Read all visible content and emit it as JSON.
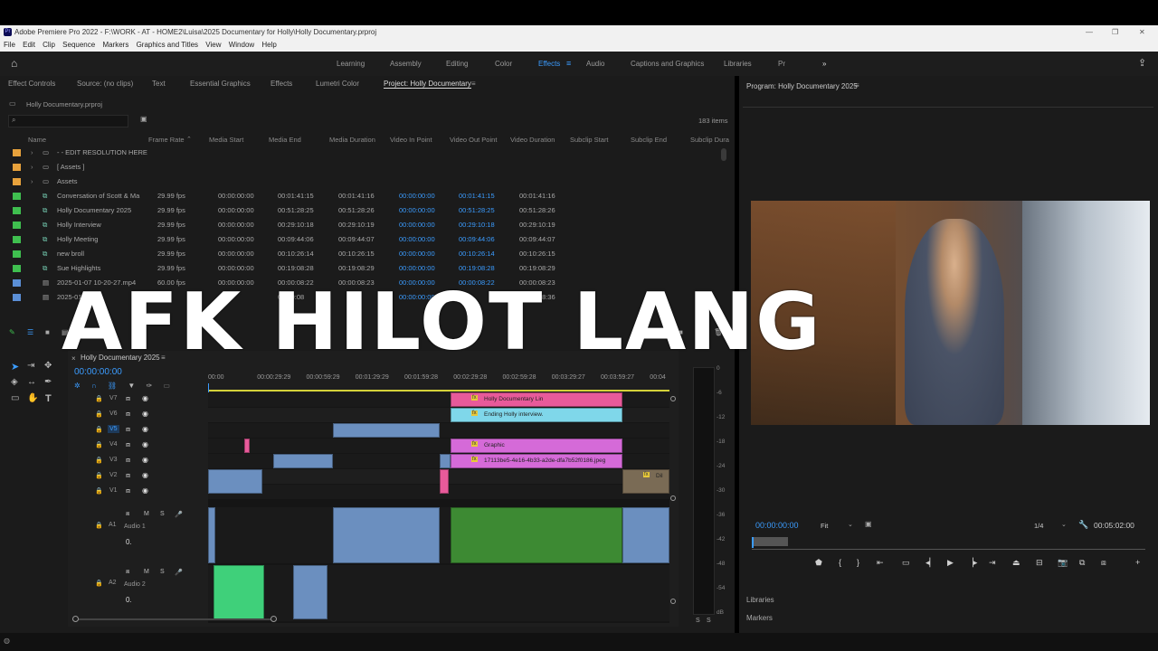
{
  "app": {
    "title": "Adobe Premiere Pro 2022 - F:\\WORK - AT - HOME2\\Luisa\\2025 Documentary for Holly\\Holly Documentary.prproj",
    "icon_text": "Pr"
  },
  "menu": [
    "File",
    "Edit",
    "Clip",
    "Sequence",
    "Markers",
    "Graphics and Titles",
    "View",
    "Window",
    "Help"
  ],
  "workspaces": {
    "items": [
      "Learning",
      "Assembly",
      "Editing",
      "Color",
      "Effects",
      "Audio",
      "Captions and Graphics",
      "Libraries",
      "Pr"
    ],
    "active": "Effects",
    "more": "»"
  },
  "left_tabs": [
    "Effect Controls",
    "Source: (no clips)",
    "Text",
    "Essential Graphics",
    "Effects",
    "Lumetri Color",
    "Project: Holly Documentary"
  ],
  "project": {
    "filename": "Holly Documentary.prproj",
    "item_count": "183 items",
    "columns": [
      "Name",
      "Frame Rate",
      "Media Start",
      "Media End",
      "Media Duration",
      "Video In Point",
      "Video Out Point",
      "Video Duration",
      "Subclip Start",
      "Subclip End",
      "Subclip Dura"
    ],
    "rows": [
      {
        "name": "- - EDIT RESOLUTION HERE",
        "color": "#e8a23c",
        "type": "bin",
        "fps": "",
        "ms": "",
        "me": "",
        "md": "",
        "vin": "",
        "vout": "",
        "vd": ""
      },
      {
        "name": "[ Assets ]",
        "color": "#e8a23c",
        "type": "bin",
        "fps": "",
        "ms": "",
        "me": "",
        "md": "",
        "vin": "",
        "vout": "",
        "vd": ""
      },
      {
        "name": "Assets",
        "color": "#e8a23c",
        "type": "bin",
        "fps": "",
        "ms": "",
        "me": "",
        "md": "",
        "vin": "",
        "vout": "",
        "vd": ""
      },
      {
        "name": "Conversation of Scott & Ma",
        "color": "#3fbf4f",
        "type": "seq",
        "fps": "29.99 fps",
        "ms": "00:00:00:00",
        "me": "00:01:41:15",
        "md": "00:01:41:16",
        "vin": "00:00:00:00",
        "vout": "00:01:41:15",
        "vd": "00:01:41:16"
      },
      {
        "name": "Holly Documentary 2025",
        "color": "#3fbf4f",
        "type": "seq",
        "fps": "29.99 fps",
        "ms": "00:00:00:00",
        "me": "00:51:28:25",
        "md": "00:51:28:26",
        "vin": "00:00:00:00",
        "vout": "00:51:28:25",
        "vd": "00:51:28:26"
      },
      {
        "name": "Holly Interview",
        "color": "#3fbf4f",
        "type": "seq",
        "fps": "29.99 fps",
        "ms": "00:00:00:00",
        "me": "00:29:10:18",
        "md": "00:29:10:19",
        "vin": "00:00:00:00",
        "vout": "00:29:10:18",
        "vd": "00:29:10:19"
      },
      {
        "name": "Holly Meeting",
        "color": "#3fbf4f",
        "type": "seq",
        "fps": "29.99 fps",
        "ms": "00:00:00:00",
        "me": "00:09:44:06",
        "md": "00:09:44:07",
        "vin": "00:00:00:00",
        "vout": "00:09:44:06",
        "vd": "00:09:44:07"
      },
      {
        "name": "new broll",
        "color": "#3fbf4f",
        "type": "seq",
        "fps": "29.99 fps",
        "ms": "00:00:00:00",
        "me": "00:10:26:14",
        "md": "00:10:26:15",
        "vin": "00:00:00:00",
        "vout": "00:10:26:14",
        "vd": "00:10:26:15"
      },
      {
        "name": "Sue Highlights",
        "color": "#3fbf4f",
        "type": "seq",
        "fps": "29.99 fps",
        "ms": "00:00:00:00",
        "me": "00:19:08:28",
        "md": "00:19:08:29",
        "vin": "00:00:00:00",
        "vout": "00:19:08:28",
        "vd": "00:19:08:29"
      },
      {
        "name": "2025-01-07 10-20-27.mp4",
        "color": "#5b8fd6",
        "type": "file",
        "fps": "60.00 fps",
        "ms": "00:00:00:00",
        "me": "00:00:08:22",
        "md": "00:00:08:23",
        "vin": "00:00:00:00",
        "vout": "00:00:08:22",
        "vd": "00:00:08:23"
      },
      {
        "name": "2025-01-07",
        "color": "#5b8fd6",
        "type": "file",
        "fps": "",
        "ms": "",
        "me": "00:00:08",
        "md": "",
        "vin": "00:00:00:00",
        "vout": "",
        "vd": "00:00:08:36"
      }
    ]
  },
  "overlay": {
    "text": "AFK HILOT LANG"
  },
  "timeline": {
    "tab": "Holly Documentary 2025",
    "timecode": "00:00:00:00",
    "ruler": [
      "00:00",
      "00:00:29:29",
      "00:00:59:29",
      "00:01:29:29",
      "00:01:59:28",
      "00:02:29:28",
      "00:02:59:28",
      "00:03:29:27",
      "00:03:59:27",
      "00:04"
    ],
    "video_tracks": [
      "V7",
      "V6",
      "V5",
      "V4",
      "V3",
      "V2",
      "V1"
    ],
    "audio_tracks": [
      {
        "id": "A1",
        "name": "Audio 1",
        "vol": "0."
      },
      {
        "id": "A2",
        "name": "Audio 2",
        "vol": "0."
      }
    ],
    "clip_labels": {
      "c1": "Holly Documentary Lin",
      "c2": "Ending Holly interview.",
      "c3": "Graphic",
      "c4": "17113be5-4e16-4b33-a2de-dfa7b52f0186.jpeg",
      "c5": "Dil"
    },
    "fx": "fx",
    "m": "M",
    "s": "S"
  },
  "meter": {
    "scale": [
      "0",
      "-6",
      "-12",
      "-18",
      "-24",
      "-30",
      "-36",
      "-42",
      "-48",
      "-54",
      "dB"
    ],
    "buttons": [
      "S",
      "S"
    ]
  },
  "program": {
    "title": "Program: Holly Documentary 2025",
    "timecode": "00:00:00:00",
    "fit": "Fit",
    "resolution": "1/4",
    "duration": "00:05:02:00"
  },
  "bottom_right": [
    "Libraries",
    "Markers"
  ],
  "colors": {
    "accent": "#3b9cff",
    "pink": "#e85a9a",
    "cyan": "#7fd7ea",
    "magenta": "#d56ad8",
    "green": "#3d8a33",
    "audio_blue": "#6b8fbf"
  }
}
